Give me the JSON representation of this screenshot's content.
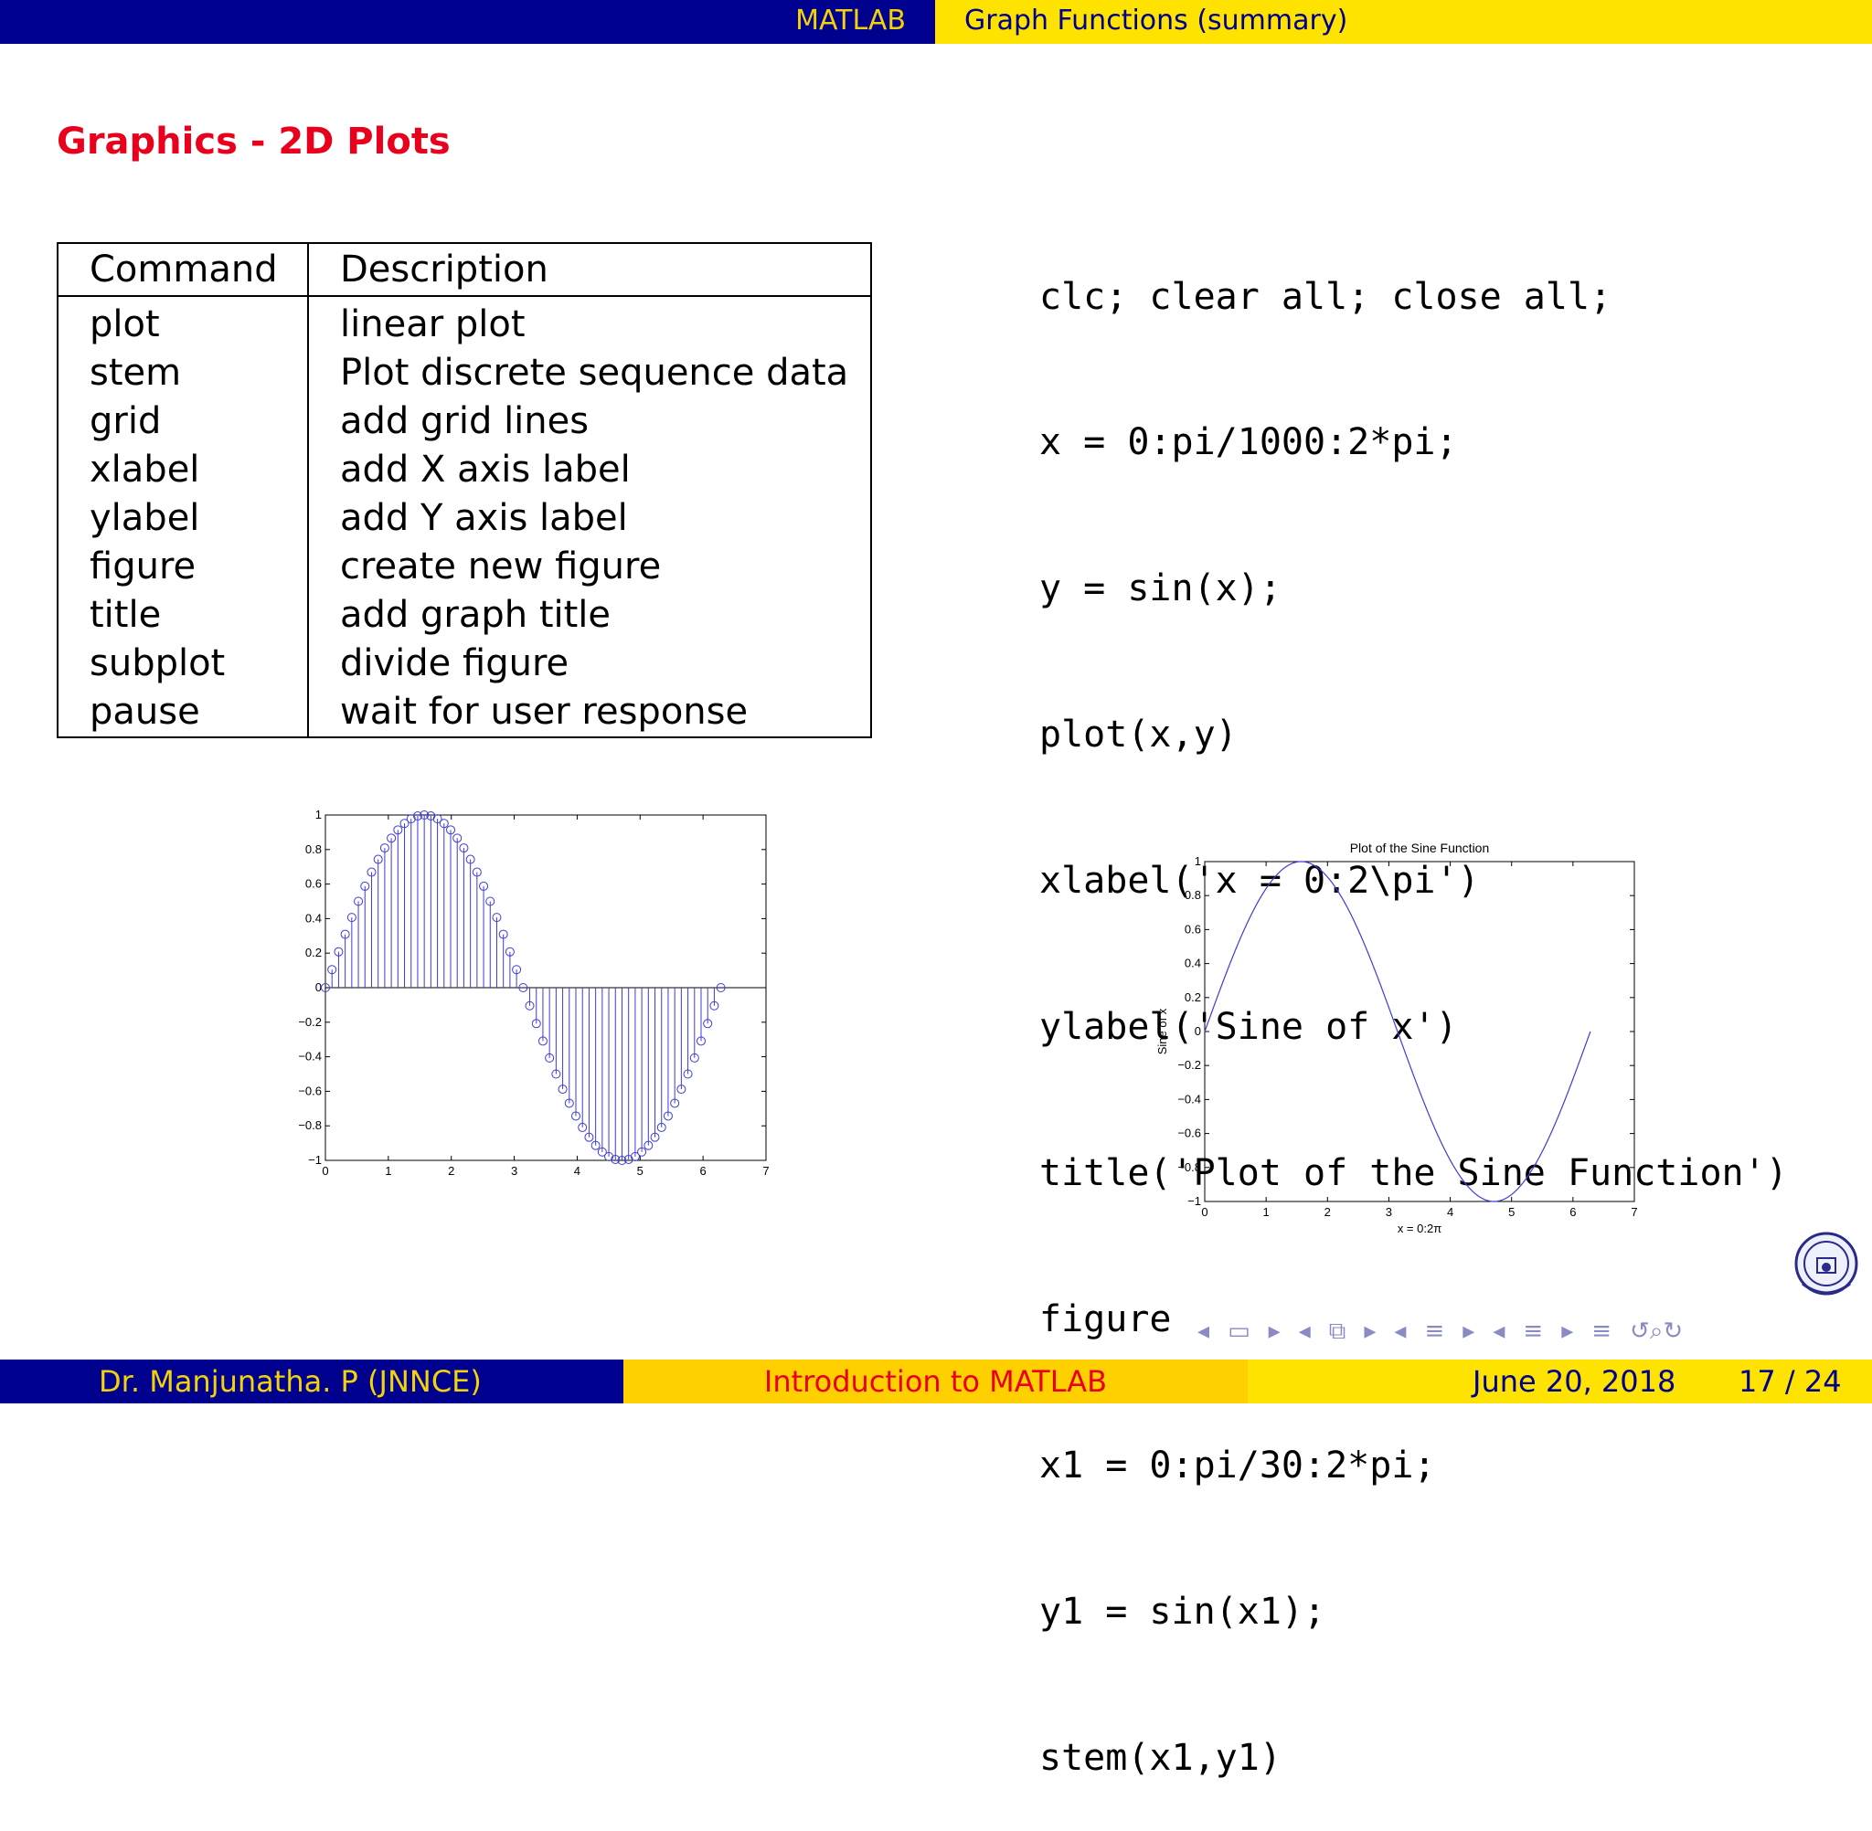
{
  "header": {
    "section": "MATLAB",
    "subsection": "Graph Functions (summary)"
  },
  "frame_title": "Graphics - 2D Plots",
  "table": {
    "headers": [
      "Command",
      "Description"
    ],
    "rows": [
      [
        "plot",
        "linear plot"
      ],
      [
        "stem",
        "Plot discrete sequence data"
      ],
      [
        "grid",
        "add grid lines"
      ],
      [
        "xlabel",
        "add X axis label"
      ],
      [
        "ylabel",
        "add Y axis label"
      ],
      [
        "figure",
        "create new figure"
      ],
      [
        "title",
        "add graph title"
      ],
      [
        "subplot",
        "divide figure"
      ],
      [
        "pause",
        "wait for user response"
      ]
    ]
  },
  "code_lines": [
    "clc; clear all; close all;",
    "x = 0:pi/1000:2*pi;",
    "y = sin(x);",
    "plot(x,y)",
    "xlabel('x = 0:2\\pi')",
    "ylabel('Sine of x')",
    "title('Plot of the Sine Function')",
    "figure",
    "x1 = 0:pi/30:2*pi;",
    "y1 = sin(x1);",
    "stem(x1,y1)"
  ],
  "chart_data": [
    {
      "type": "stem",
      "title": "",
      "xlabel": "",
      "ylabel": "",
      "function": "sin",
      "x": {
        "start": 0,
        "step_in_pi": 0.03333333333333333,
        "end_in_pi": 2
      },
      "xlim": [
        0,
        7
      ],
      "ylim": [
        -1,
        1
      ],
      "xticks": [
        "0",
        "1",
        "2",
        "3",
        "4",
        "5",
        "6",
        "7"
      ],
      "yticks": [
        "1",
        "0.8",
        "0.6",
        "0.4",
        "0.2",
        "0",
        "−0.2",
        "−0.4",
        "−0.6",
        "−0.8",
        "−1"
      ],
      "color": "#3b3bdc",
      "grid": false
    },
    {
      "type": "line",
      "title": "Plot of the Sine Function",
      "xlabel": "x = 0:2π",
      "ylabel": "Sine of x",
      "function": "sin",
      "x": {
        "start": 0,
        "step_in_pi": 0.001,
        "end_in_pi": 2
      },
      "xlim": [
        0,
        7
      ],
      "ylim": [
        -1,
        1
      ],
      "xticks": [
        "0",
        "1",
        "2",
        "3",
        "4",
        "5",
        "6",
        "7"
      ],
      "yticks": [
        "1",
        "0.8",
        "0.6",
        "0.4",
        "0.2",
        "0",
        "−0.2",
        "−0.4",
        "−0.6",
        "−0.8",
        "−1"
      ],
      "color": "#3b3bdc",
      "grid": false
    }
  ],
  "logo": {
    "alt": "JNN College of Engineering emblem"
  },
  "footer": {
    "author": "Dr. Manjunatha. P   (JNNCE)",
    "talk_title": "Introduction to MATLAB",
    "date": "June 20, 2018",
    "page": "17 / 24"
  },
  "colors": {
    "dark_blue": "#00008f",
    "yellow": "#ffe300",
    "orange_yellow": "#ffd000",
    "red": "#e8001c",
    "nav_gray_blue": "#8a8ac4"
  }
}
